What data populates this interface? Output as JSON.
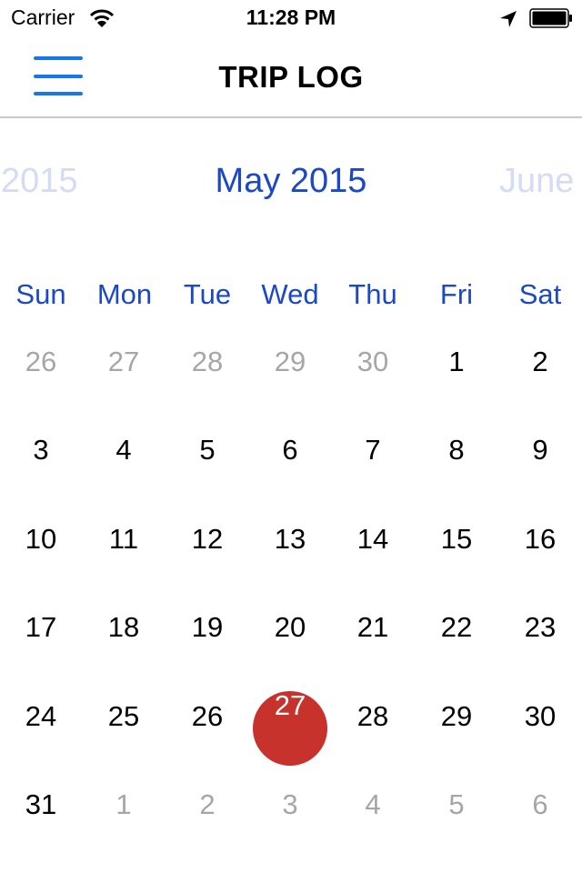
{
  "status_bar": {
    "carrier": "Carrier",
    "time": "11:28 PM",
    "icons": [
      "wifi-icon",
      "location-arrow-icon",
      "battery-icon"
    ]
  },
  "nav": {
    "title": "TRIP LOG",
    "menu_icon": "hamburger-menu-icon",
    "accent": "#1677e8"
  },
  "month_strip": {
    "previous": "2015",
    "current": "May 2015",
    "next": "June",
    "current_color": "#1b48c4",
    "faded_color": "#d3dcf4"
  },
  "weekdays": [
    "Sun",
    "Mon",
    "Tue",
    "Wed",
    "Thu",
    "Fri",
    "Sat"
  ],
  "calendar": {
    "selected_date": "27",
    "selected_color": "#c7322c",
    "weeks": [
      [
        {
          "d": "26",
          "out": true
        },
        {
          "d": "27",
          "out": true
        },
        {
          "d": "28",
          "out": true
        },
        {
          "d": "29",
          "out": true
        },
        {
          "d": "30",
          "out": true
        },
        {
          "d": "1"
        },
        {
          "d": "2"
        }
      ],
      [
        {
          "d": "3"
        },
        {
          "d": "4"
        },
        {
          "d": "5"
        },
        {
          "d": "6"
        },
        {
          "d": "7"
        },
        {
          "d": "8"
        },
        {
          "d": "9"
        }
      ],
      [
        {
          "d": "10"
        },
        {
          "d": "11"
        },
        {
          "d": "12"
        },
        {
          "d": "13"
        },
        {
          "d": "14"
        },
        {
          "d": "15"
        },
        {
          "d": "16"
        }
      ],
      [
        {
          "d": "17"
        },
        {
          "d": "18"
        },
        {
          "d": "19"
        },
        {
          "d": "20"
        },
        {
          "d": "21"
        },
        {
          "d": "22"
        },
        {
          "d": "23"
        }
      ],
      [
        {
          "d": "24"
        },
        {
          "d": "25"
        },
        {
          "d": "26"
        },
        {
          "d": "27",
          "selected": true
        },
        {
          "d": "28"
        },
        {
          "d": "29"
        },
        {
          "d": "30"
        }
      ],
      [
        {
          "d": "31"
        },
        {
          "d": "1",
          "out": true
        },
        {
          "d": "2",
          "out": true
        },
        {
          "d": "3",
          "out": true
        },
        {
          "d": "4",
          "out": true
        },
        {
          "d": "5",
          "out": true
        },
        {
          "d": "6",
          "out": true
        }
      ]
    ]
  }
}
